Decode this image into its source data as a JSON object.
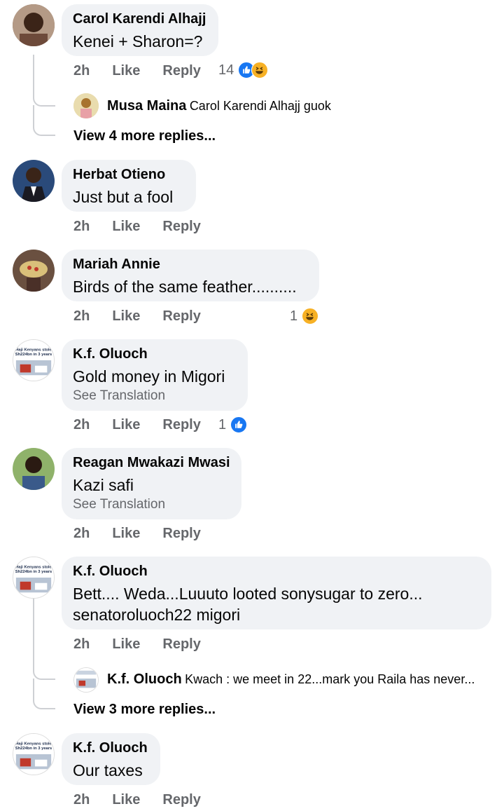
{
  "colors": {
    "bubble": "#f0f2f5",
    "muted": "#65676b",
    "like_blue": "#1877f2",
    "haha_yellow": "#f7b125"
  },
  "comments": [
    {
      "author": "Carol Karendi Alhajj",
      "text": "Kenei + Sharon=?",
      "time": "2h",
      "like": "Like",
      "reply": "Reply",
      "reactions": {
        "count": "14",
        "icons": [
          "like-icon",
          "haha-icon"
        ]
      },
      "reply_preview": {
        "author": "Musa Maina",
        "text": "Carol Karendi Alhajj guok"
      },
      "more_replies": "View 4 more replies..."
    },
    {
      "author": "Herbat Otieno",
      "text": "Just but a fool",
      "time": "2h",
      "like": "Like",
      "reply": "Reply"
    },
    {
      "author": "Mariah Annie",
      "text": "Birds of the same feather..........",
      "time": "2h",
      "like": "Like",
      "reply": "Reply",
      "reactions": {
        "count": "1",
        "icons": [
          "haha-icon"
        ]
      }
    },
    {
      "author": "K.f. Oluoch",
      "text": "Gold money in Migori",
      "see_translation": "See Translation",
      "time": "2h",
      "like": "Like",
      "reply": "Reply",
      "reactions": {
        "count": "1",
        "icons": [
          "like-icon"
        ]
      }
    },
    {
      "author": "Reagan Mwakazi Mwasi",
      "text": "Kazi safi",
      "see_translation": "See Translation",
      "time": "2h",
      "like": "Like",
      "reply": "Reply"
    },
    {
      "author": "K.f. Oluoch",
      "text_line1": "Bett.... Weda...Luuuto looted sonysugar to zero...",
      "text_line2": "senatoroluoch22 migori",
      "time": "2h",
      "like": "Like",
      "reply": "Reply",
      "reply_preview": {
        "author": "K.f. Oluoch",
        "text": "Kwach : we meet in 22...mark you Raila has never..."
      },
      "more_replies": "View 3 more replies..."
    },
    {
      "author": "K.f. Oluoch",
      "text": "Our taxes",
      "time": "2h",
      "like": "Like",
      "reply": "Reply"
    }
  ],
  "thumb_text": "Haji Kenyans stole Sh224bn in 3 years"
}
